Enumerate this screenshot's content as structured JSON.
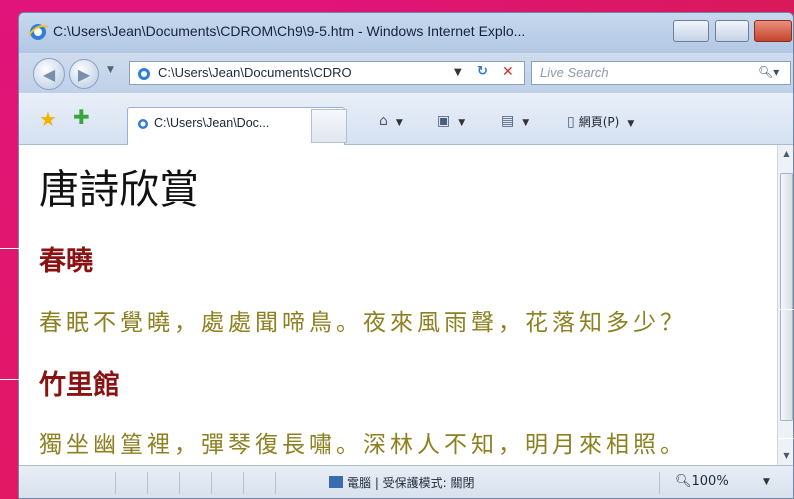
{
  "window": {
    "title": "C:\\Users\\Jean\\Documents\\CDROM\\Ch9\\9-5.htm - Windows Internet Explo..."
  },
  "address_bar": {
    "url": "C:\\Users\\Jean\\Documents\\CDRO"
  },
  "search": {
    "placeholder": "Live Search"
  },
  "tab": {
    "label": "C:\\Users\\Jean\\Doc..."
  },
  "toolbar": {
    "page_label": "網頁(P)"
  },
  "content": {
    "heading": "唐詩欣賞",
    "poems": [
      {
        "title": "春曉",
        "text": "春眠不覺曉，處處聞啼鳥。夜來風雨聲，花落知多少？"
      },
      {
        "title": "竹里館",
        "text": "獨坐幽篁裡，彈琴復長嘯。深林人不知，明月來相照。"
      }
    ]
  },
  "status_bar": {
    "zone": "電腦 | 受保護模式: 關閉",
    "zoom": "100%"
  },
  "colors": {
    "poem_title": "#8b1212",
    "poem_text": "#8c8020",
    "background": "#e0147a"
  },
  "icons": [
    "ie-icon",
    "back-icon",
    "forward-icon",
    "refresh-icon",
    "stop-icon",
    "search-icon",
    "favorites-star-icon",
    "add-favorites-icon",
    "home-icon",
    "feeds-icon",
    "print-icon",
    "page-icon",
    "zone-computer-icon",
    "zoom-icon"
  ]
}
